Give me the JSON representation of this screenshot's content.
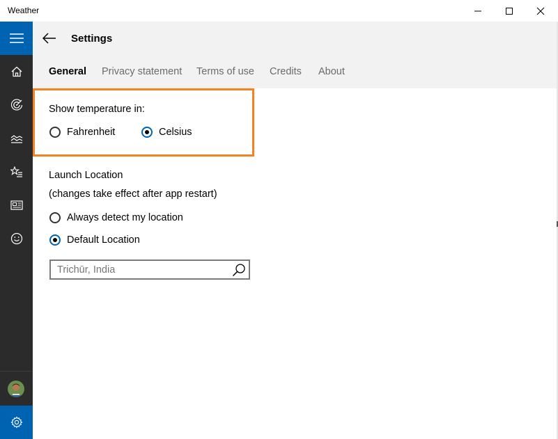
{
  "window": {
    "title": "Weather",
    "controls": [
      "minimize-icon",
      "maximize-icon",
      "close-icon"
    ]
  },
  "nav": {
    "items": [
      {
        "name": "home",
        "icon": "home-icon"
      },
      {
        "name": "maps",
        "icon": "radar-icon"
      },
      {
        "name": "historical-weather",
        "icon": "chart-icon"
      },
      {
        "name": "favorites",
        "icon": "star-list-icon"
      },
      {
        "name": "news",
        "icon": "news-icon"
      },
      {
        "name": "feedback",
        "icon": "smiley-icon"
      }
    ],
    "accent_color": "#0063b1",
    "background_color": "#2b2b2b"
  },
  "header": {
    "title": "Settings",
    "tabs": [
      {
        "label": "General",
        "active": true
      },
      {
        "label": "Privacy statement",
        "active": false
      },
      {
        "label": "Terms of use",
        "active": false
      },
      {
        "label": "Credits",
        "active": false
      },
      {
        "label": "About",
        "active": false
      }
    ]
  },
  "temperature": {
    "label": "Show temperature in:",
    "options": [
      {
        "label": "Fahrenheit",
        "checked": false
      },
      {
        "label": "Celsius",
        "checked": true
      }
    ],
    "highlight_color": "#f58220"
  },
  "launch_location": {
    "label": "Launch Location",
    "note": "(changes take effect after app restart)",
    "options": [
      {
        "label": "Always detect my location",
        "checked": false
      },
      {
        "label": "Default Location",
        "checked": true
      }
    ],
    "search": {
      "value": "",
      "placeholder": "Trichūr, India"
    }
  }
}
